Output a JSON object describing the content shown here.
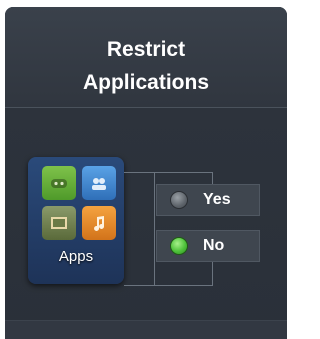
{
  "header": {
    "title": "Restrict\nApplications"
  },
  "apps_tile": {
    "label": "Apps",
    "icon": "apps-folder-icon"
  },
  "options": [
    {
      "label": "Yes",
      "selected": false
    },
    {
      "label": "No",
      "selected": true
    }
  ],
  "colors": {
    "selected_radio": "#4ec23a",
    "unselected_radio": "#5d636a",
    "panel_background": "#2d333c"
  }
}
